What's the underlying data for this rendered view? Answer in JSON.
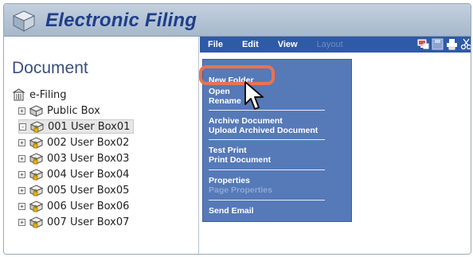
{
  "app": {
    "title": "Electronic Filing",
    "logo_icon": "cube-icon"
  },
  "left_pane": {
    "title": "Document",
    "root": {
      "label": "e-Filing",
      "icon": "building-icon"
    },
    "items": [
      {
        "label": "Public Box",
        "expander": "+",
        "icon": "box-icon",
        "locked": false,
        "selected": false
      },
      {
        "label": "001 User Box01",
        "expander": "-",
        "icon": "locked-box-icon",
        "locked": true,
        "selected": true
      },
      {
        "label": "002 User Box02",
        "expander": "+",
        "icon": "locked-box-icon",
        "locked": true,
        "selected": false
      },
      {
        "label": "003 User Box03",
        "expander": "+",
        "icon": "locked-box-icon",
        "locked": true,
        "selected": false
      },
      {
        "label": "004 User Box04",
        "expander": "+",
        "icon": "locked-box-icon",
        "locked": true,
        "selected": false
      },
      {
        "label": "005 User Box05",
        "expander": "+",
        "icon": "locked-box-icon",
        "locked": true,
        "selected": false
      },
      {
        "label": "006 User Box06",
        "expander": "+",
        "icon": "locked-box-icon",
        "locked": true,
        "selected": false
      },
      {
        "label": "007 User Box07",
        "expander": "+",
        "icon": "locked-box-icon",
        "locked": true,
        "selected": false
      }
    ]
  },
  "menubar": {
    "file": "File",
    "edit": "Edit",
    "view": "View",
    "layout": "Layout",
    "toolbar_icons": [
      "monitor-icon",
      "save-icon",
      "print-icon",
      "scissors-icon"
    ]
  },
  "file_menu": {
    "new_folder": "New Folder",
    "open": "Open",
    "rename": "Rename",
    "archive_document": "Archive Document",
    "upload_archived_document": "Upload Archived Document",
    "test_print": "Test Print",
    "print_document": "Print Document",
    "properties": "Properties",
    "page_properties": "Page Properties",
    "send_email": "Send Email"
  },
  "colors": {
    "menubar": "#2f5aa6",
    "dropdown": "#5679b8",
    "highlight": "#ea7252",
    "title_text": "#1f3e8a"
  }
}
